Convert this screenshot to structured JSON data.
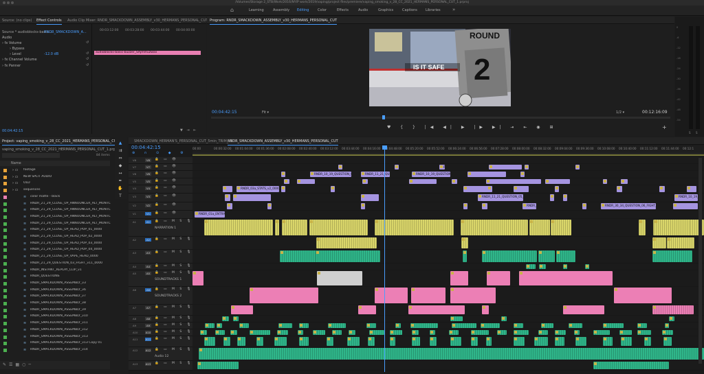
{
  "window": {
    "title": "/Volumes/Storage 2_STB/Work/2016/NYIP work/2019/vaping/project files/premiere/vaping_smoking_v_28_CC_2021_HERMANS_PERSONAL_CUT_1.prproj"
  },
  "workspaces": {
    "tabs": [
      "Learning",
      "Assembly",
      "Editing",
      "Color",
      "Effects",
      "Audio",
      "Graphics",
      "Captions",
      "Libraries"
    ],
    "active": "Editing"
  },
  "effect_controls": {
    "tabs": [
      "Source: (no clips)",
      "Effect Controls",
      "Audio Clip Mixer: RNDR_SMACKDOWN_ASSEMBLY_v30_HERMANS_PERSONAL_CUT"
    ],
    "source_line": "Source * audioblocks-basic-...",
    "clip_name": "RNDR_SMACKDOWN_A...",
    "section": "Audio",
    "rows": [
      "Volume",
      "Bypass",
      "Level",
      "Channel Volume",
      "Panner"
    ],
    "level_value": "-12.0 dB",
    "ruler": [
      "00:03:12:00",
      "00:03:28:00",
      "00:03:44:00",
      "00:04:00:00"
    ],
    "clip_label": "audioblocks-basic-buzzer_SAjmmuzwax",
    "timecode": "00:04:42:15"
  },
  "program": {
    "title": "Program: RNDR_SMACKDOWN_ASSEMBLY_v30_HERMANS_PERSONAL_CUT",
    "frame_text_round": "ROUND",
    "frame_text_number": "2",
    "frame_text_banner": "IS IT SAFE",
    "timecode_left": "00:04:42:15",
    "fit": "Fit",
    "fraction": "1/2",
    "timecode_right": "00:12:16:09",
    "scrub_position": 0.375
  },
  "meter": {
    "ticks": [
      "0",
      "-6",
      "-12",
      "-18",
      "-24",
      "-30",
      "-36",
      "-42",
      "-48",
      "-54"
    ],
    "labels": [
      "S",
      "S"
    ]
  },
  "project": {
    "tab": "Project: vaping_smoking_v_28_CC_2021_HERMANS_PERSONAL_CUT_1",
    "file": "vaping_smoking_v_28_CC_2021_HERMANS_PERSONAL_CUT_1.prproj",
    "count": "84 items",
    "column": "Name",
    "items": [
      {
        "label": "footage",
        "color": "#e8a33a"
      },
      {
        "label": "NEW SPLIT AUDIO",
        "color": "#e8a33a"
      },
      {
        "label": "OLD",
        "color": "#e8a33a"
      },
      {
        "label": "sequences",
        "color": "#e8a33a"
      },
      {
        "label": "color matte - black",
        "color": "#e87fb2"
      },
      {
        "label": "RNDR_21_29_CLOSE_UP_ANNOUNCER_ALT_MONTC",
        "color": "#4cb050"
      },
      {
        "label": "RNDR_21_29_CLOSE_UP_ANNOUNCER_ALT_MONTC",
        "color": "#4cb050"
      },
      {
        "label": "RNDR_21_29_CLOSE_UP_ANNOUNCER_ALT_MONTC",
        "color": "#4cb050"
      },
      {
        "label": "RNDR_21_29_CLOSE_UP_ANNOUNCER_ALT_MONTC",
        "color": "#4cb050"
      },
      {
        "label": "RNDR_21_29_CLOSE_UP_HEAD_POP_01_0000",
        "color": "#4cb050"
      },
      {
        "label": "RNDR_21_29_CLOSE_UP_HEAD_POP_02_0000",
        "color": "#4cb050"
      },
      {
        "label": "RNDR_21_29_CLOSE_UP_HEAD_POP_03_0000",
        "color": "#4cb050"
      },
      {
        "label": "RNDR_21_29_CLOSE_UP_HEAD_POP_04_0000",
        "color": "#4cb050"
      },
      {
        "label": "RNDR_21_29_CLOSE_UP_VAPE_HEAD_0000",
        "color": "#4cb050"
      },
      {
        "label": "RNDR_21_29_QUESTION_03_FIGHT_v11_0000",
        "color": "#4cb050"
      },
      {
        "label": "RNDR_INSTANT_REPLAY_CLIP_v1",
        "color": "#4cb050"
      },
      {
        "label": "RNDR_QUESTIONS",
        "color": "#4cb050"
      },
      {
        "label": "RNDR_SMACKDOWN_ASSEMBLY_v3",
        "color": "#4cb050"
      },
      {
        "label": "RNDR_SMACKDOWN_ASSEMBLY_v6",
        "color": "#4cb050"
      },
      {
        "label": "RNDR_SMACKDOWN_ASSEMBLY_v7",
        "color": "#4cb050"
      },
      {
        "label": "RNDR_SMACKDOWN_ASSEMBLY_v8",
        "color": "#4cb050"
      },
      {
        "label": "RNDR_SMACKDOWN_ASSEMBLY_v9",
        "color": "#4cb050"
      },
      {
        "label": "RNDR_SMACKDOWN_ASSEMBLY_v10",
        "color": "#4cb050"
      },
      {
        "label": "RNDR_SMACKDOWN_ASSEMBLY_v11",
        "color": "#4cb050"
      },
      {
        "label": "RNDR_SMACKDOWN_ASSEMBLY_v12",
        "color": "#4cb050"
      },
      {
        "label": "RNDR_SMACKDOWN_ASSEMBLY_v13",
        "color": "#4cb050"
      },
      {
        "label": "RNDR_SMACKDOWN_ASSEMBLY_v13 Copy 01",
        "color": "#4cb050"
      },
      {
        "label": "RNDR_SMACKDOWN_ASSEMBLY_v14",
        "color": "#4cb050"
      }
    ]
  },
  "timeline": {
    "tabs": [
      "SMACKDOWN_HERMAN'S_PERSONAL_CUT_5min_TRIM_v5",
      "RNDR_SMACKDOWN_ASSEMBLY_v30_HERMANS_PERSONAL_CUT"
    ],
    "timecode": "00:04:42:15",
    "ruler": [
      "00:00",
      "00:00:32:00",
      "00:01:04:00",
      "00:01:36:00",
      "00:02:08:00",
      "00:02:40:00",
      "00:03:12:00",
      "00:03:44:00",
      "00:04:16:00",
      "00:04:48:00",
      "00:05:20:00",
      "00:05:52:00",
      "00:06:24:00",
      "00:06:56:00",
      "00:07:28:00",
      "00:08:00:00",
      "00:08:32:00",
      "00:09:04:00",
      "00:09:36:00",
      "00:10:08:00",
      "00:10:40:00",
      "00:11:12:00",
      "00:11:44:00",
      "00:12:1"
    ],
    "tracks": [
      {
        "id": "V8",
        "kind": "video",
        "name": ""
      },
      {
        "id": "V7",
        "kind": "video",
        "name": ""
      },
      {
        "id": "V6",
        "kind": "video",
        "name": ""
      },
      {
        "id": "V5",
        "kind": "video",
        "name": ""
      },
      {
        "id": "V4",
        "kind": "video",
        "name": ""
      },
      {
        "id": "V3",
        "kind": "video",
        "name": ""
      },
      {
        "id": "V2",
        "kind": "video",
        "name": ""
      },
      {
        "id": "V1",
        "kind": "video",
        "name": ""
      },
      {
        "id": "A1",
        "kind": "audio",
        "name": "NARRATION 1"
      },
      {
        "id": "A2",
        "kind": "audio",
        "name": ""
      },
      {
        "id": "A3",
        "kind": "audio",
        "name": ""
      },
      {
        "id": "A4",
        "kind": "audio",
        "name": ""
      },
      {
        "id": "A5",
        "kind": "audio",
        "name": "SOUNDTRACKS 1"
      },
      {
        "id": "A6",
        "kind": "audio",
        "name": "SOUNDTRACKS 2"
      },
      {
        "id": "A7",
        "kind": "audio",
        "name": ""
      },
      {
        "id": "A8",
        "kind": "audio",
        "name": ""
      },
      {
        "id": "A9",
        "kind": "audio",
        "name": ""
      },
      {
        "id": "A10",
        "kind": "audio",
        "name": ""
      },
      {
        "id": "A11",
        "kind": "audio",
        "name": ""
      },
      {
        "id": "A12",
        "kind": "audio",
        "name": "Audio 12"
      },
      {
        "id": "A13",
        "kind": "audio",
        "name": ""
      }
    ],
    "clip_labels": {
      "q": "RNDR_10_19_QUESTION_09_FIGHT",
      "stats": "RNDR_03a_STATS_v2_0000.png",
      "entrance": "RNDR_01a_ENTRANCE",
      "q14": "RNDR_11_21_QUESTION_05_FIGH",
      "q18": "RNDR_30_34_QUESTION_06_FIGHT_v20",
      "q21": "RNDR_21_7"
    }
  }
}
